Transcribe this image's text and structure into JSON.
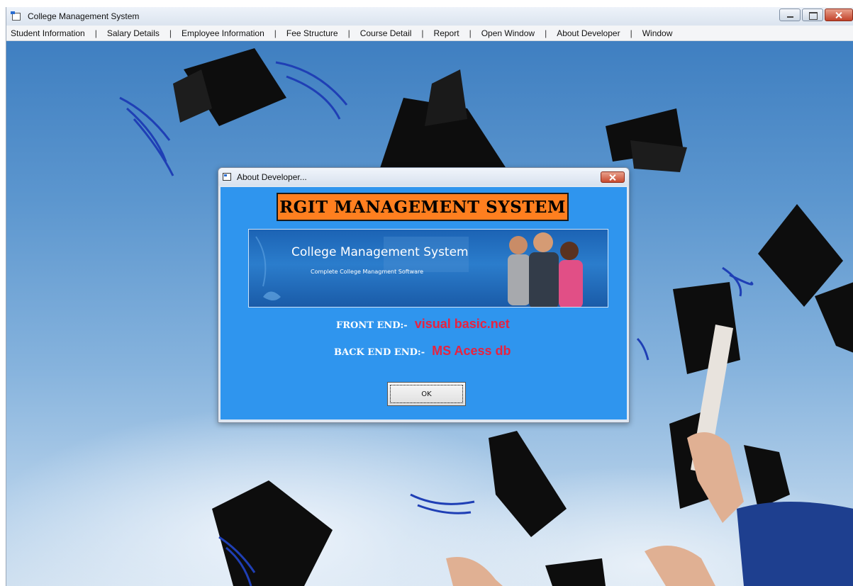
{
  "window": {
    "title": "College Management System",
    "icon": "app-window-icon",
    "controls": [
      "minimize-icon",
      "maximize-icon",
      "close-icon"
    ]
  },
  "menu": {
    "items": [
      {
        "label": "Student Information"
      },
      {
        "label": "Salary Details"
      },
      {
        "label": "Employee Information"
      },
      {
        "label": "Fee Structure"
      },
      {
        "label": "Course Detail"
      },
      {
        "label": "Report"
      },
      {
        "label": "Open Window"
      },
      {
        "label": "About Developer"
      },
      {
        "label": "Window"
      }
    ],
    "separator": "|"
  },
  "dialog": {
    "title": "About Developer...",
    "banner": "RGIT MANAGEMENT SYSTEM",
    "promo": {
      "title": "College Management System",
      "subtitle": "Complete College Managment Software"
    },
    "front_end_label": "FRONT END:-",
    "front_end_value": "visual basic.net",
    "back_end_label": "BACK END END:-",
    "back_end_value": "MS Acess db",
    "ok_label": "OK"
  },
  "colors": {
    "dialog_body": "#2f95ee",
    "banner_bg": "#ff7f1f",
    "value_text": "#e8223f"
  }
}
